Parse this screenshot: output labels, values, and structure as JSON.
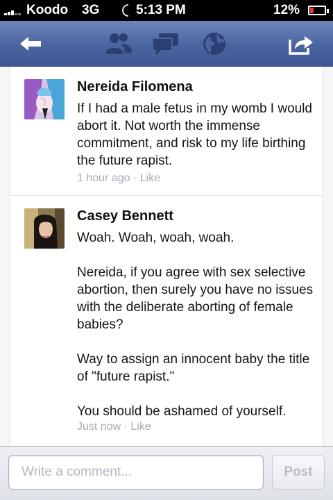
{
  "status_bar": {
    "carrier": "Koodo",
    "network": "3G",
    "time": "5:13 PM",
    "battery_percent": "12%",
    "battery_level": 0.12
  },
  "nav": {
    "icons": [
      "back-arrow-icon",
      "friends-icon",
      "messages-icon",
      "globe-icon",
      "share-icon"
    ]
  },
  "comments": [
    {
      "author": "Nereida Filomena",
      "paragraphs": [
        "If I had a male fetus in  my womb I would abort it. Not worth the immense commitment, and risk to my life birthing the future rapist."
      ],
      "time": "1 hour ago",
      "separator": "·",
      "like_label": "Like"
    },
    {
      "author": "Casey Bennett",
      "paragraphs": [
        "Woah. Woah, woah, woah.",
        "Nereida, if you agree with sex selective abortion, then surely you have no issues with the deliberate aborting of female babies?",
        "Way to assign an innocent baby the title of \"future rapist.\"",
        "You should be ashamed of yourself."
      ],
      "time": "Just now",
      "separator": "·",
      "like_label": "Like"
    }
  ],
  "composer": {
    "placeholder": "Write a comment...",
    "post_label": "Post"
  },
  "colors": {
    "nav_blue": "#4a64a0",
    "battery_low": "#e53a3a"
  }
}
